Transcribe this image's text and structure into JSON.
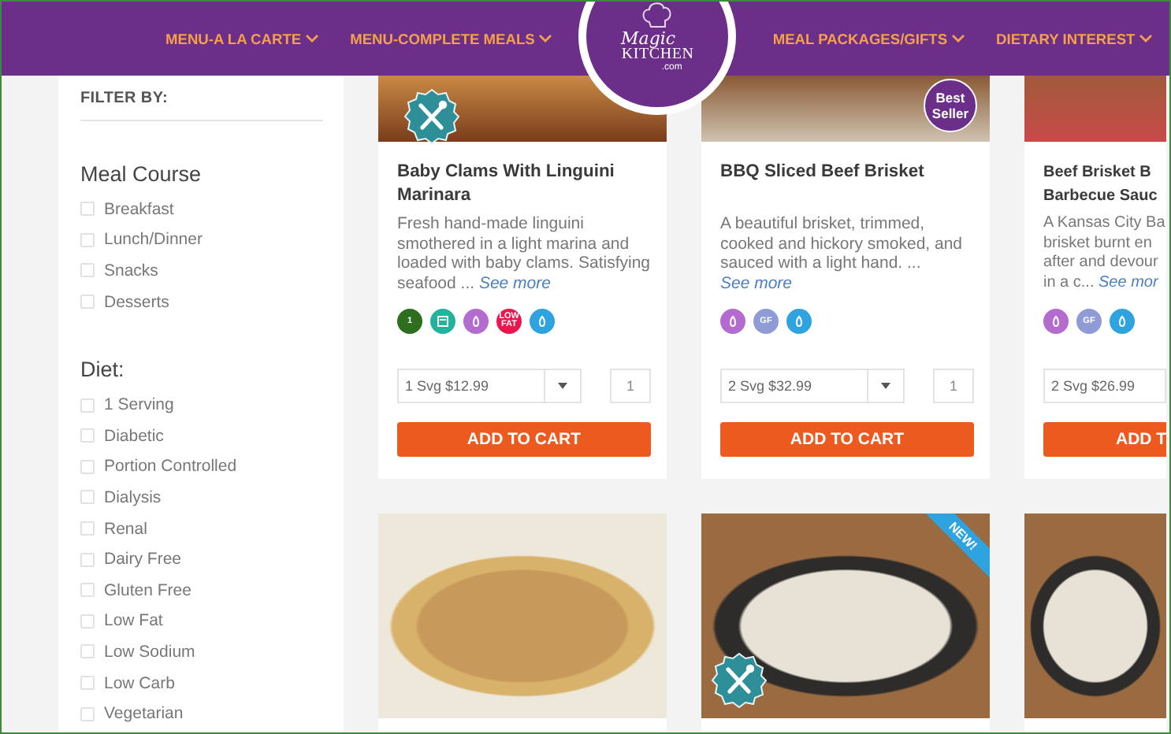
{
  "header": {
    "nav_left": [
      {
        "label": "MENU-A LA CARTE"
      },
      {
        "label": "MENU-COMPLETE MEALS"
      }
    ],
    "logo": {
      "script": "Magic",
      "word": "KITCHEN",
      "suffix": ".com"
    },
    "nav_right": [
      {
        "label": "MEAL PACKAGES/GIFTS"
      },
      {
        "label": "DIETARY INTEREST"
      }
    ]
  },
  "sidebar": {
    "title": "FILTER BY:",
    "groups": [
      {
        "heading": "Meal Course",
        "options": [
          {
            "label": "Breakfast",
            "checked": false
          },
          {
            "label": "Lunch/Dinner",
            "checked": false
          },
          {
            "label": "Snacks",
            "checked": false
          },
          {
            "label": "Desserts",
            "checked": false
          }
        ]
      },
      {
        "heading": "Diet:",
        "options": [
          {
            "label": "1 Serving",
            "checked": false
          },
          {
            "label": "Diabetic",
            "checked": false
          },
          {
            "label": "Portion Controlled",
            "checked": false
          },
          {
            "label": "Dialysis",
            "checked": false
          },
          {
            "label": "Renal",
            "checked": false
          },
          {
            "label": "Dairy Free",
            "checked": false
          },
          {
            "label": "Gluten Free",
            "checked": false
          },
          {
            "label": "Low Fat",
            "checked": false
          },
          {
            "label": "Low Sodium",
            "checked": false
          },
          {
            "label": "Low Carb",
            "checked": false
          },
          {
            "label": "Vegetarian",
            "checked": false
          }
        ]
      }
    ]
  },
  "products": [
    {
      "badges": [
        {
          "kind": "utensils"
        }
      ],
      "title": "Baby Clams With Linguini Marinara",
      "description": "Fresh hand-made linguini smothered in a light marina and loaded with baby clams. Satisfying seafood ... ",
      "see_more": "See more",
      "icons": [
        {
          "color": "#2e6e1f",
          "label": "1"
        },
        {
          "color": "#21b39b"
        },
        {
          "color": "#b36bcf"
        },
        {
          "color": "#e8184f",
          "label": "LOW FAT"
        },
        {
          "color": "#2ea3e0"
        }
      ],
      "price_select": {
        "value": "1 Svg $12.99",
        "dropdown": true
      },
      "quantity": "1",
      "button": "ADD TO CART"
    },
    {
      "badges": [
        {
          "kind": "seal",
          "label": "Best Seller"
        }
      ],
      "title": "BBQ Sliced Beef Brisket",
      "description": "A beautiful brisket, trimmed, cooked and hickory smoked, and sauced with a light hand. ... ",
      "see_more": "See more",
      "icons": [
        {
          "color": "#b36bcf"
        },
        {
          "color": "#8f9bd6",
          "label": "GF"
        },
        {
          "color": "#2ea3e0"
        }
      ],
      "price_select": {
        "value": "2 Svg $32.99",
        "dropdown": true
      },
      "quantity": "1",
      "button": "ADD TO CART"
    },
    {
      "title": "Beef Brisket B\nBarbecue Sauc",
      "description": "A Kansas City Ba\nbrisket burnt en\nafter and devour\nin a c... ",
      "see_more": "See mor",
      "icons": [
        {
          "color": "#b36bcf"
        },
        {
          "color": "#8f9bd6",
          "label": "GF"
        },
        {
          "color": "#2ea3e0"
        }
      ],
      "price_select": {
        "value": "2 Svg $26.99",
        "dropdown": false
      },
      "button": "ADD T"
    }
  ],
  "second_row": [
    {
      "kind": "plate"
    },
    {
      "kind": "tray",
      "badges": [
        {
          "kind": "utensils"
        },
        {
          "kind": "ribbon",
          "label": "NEW!"
        }
      ]
    },
    {
      "kind": "tray"
    }
  ]
}
